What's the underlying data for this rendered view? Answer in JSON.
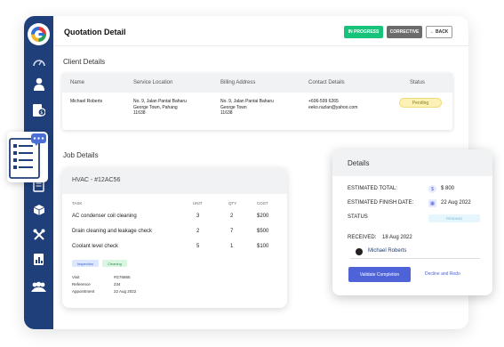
{
  "page": {
    "title": "Quotation Detail"
  },
  "header": {
    "status_label": "IN PROGRESS",
    "type_label": "CORRECTIVE",
    "back_label": "← BACK"
  },
  "sidebar": {
    "items": [
      {
        "icon": "dashboard-gauge-icon"
      },
      {
        "icon": "user-icon"
      },
      {
        "icon": "invoice-dollar-icon"
      },
      {
        "icon": "document-icon"
      },
      {
        "icon": "box-icon"
      },
      {
        "icon": "tools-icon"
      },
      {
        "icon": "report-chart-icon"
      },
      {
        "icon": "team-icon"
      }
    ]
  },
  "client": {
    "section_title": "Client Details",
    "headers": {
      "name": "Name",
      "service": "Service Location",
      "billing": "Billing Address",
      "contact": "Contact Details",
      "status": "Status"
    },
    "row": {
      "name": "Michael Roberts",
      "service": [
        "No. 9, Jalan Pantai Baharu",
        "George Town, Pahang",
        "11638"
      ],
      "billing": [
        "No. 9, Jalan Pantai Baharu",
        "George Town",
        "11638"
      ],
      "contact": [
        "+606-599 6265",
        "eeko.razlan@yahoo.com"
      ],
      "status": "Pending"
    }
  },
  "job": {
    "section_title": "Job Details",
    "card_title": "HVAC - #12AC56",
    "headers": {
      "task": "TASK",
      "unit": "UNIT",
      "qty": "QTY",
      "cost": "COST"
    },
    "rows": [
      {
        "task": "AC condenser coil cleaning",
        "unit": "3",
        "qty": "2",
        "cost": "$200"
      },
      {
        "task": "Drain cleaning and leakage check",
        "unit": "2",
        "qty": "7",
        "cost": "$500"
      },
      {
        "task": "Coolant level check",
        "unit": "5",
        "qty": "1",
        "cost": "$100"
      }
    ],
    "tags": [
      "Inspection",
      "Cleaning"
    ],
    "meta": [
      {
        "label": "Visit",
        "value": "#G76865"
      },
      {
        "label": "Reference",
        "value": "234"
      },
      {
        "label": "Appointment",
        "value": "22 Aug 2022"
      }
    ]
  },
  "details": {
    "title": "Details",
    "estimated_total_label": "ESTIMATED TOTAL:",
    "estimated_total": "$ 800",
    "finish_date_label": "ESTIMATED FINISH DATE:",
    "finish_date": "22 Aug 2022",
    "status_label": "STATUS",
    "status_value": "PENDING",
    "received_label": "RECEIVED:",
    "received_date": "18 Aug 2022",
    "assignee": "Michael Roberts",
    "validate_label": "Validate Completion",
    "decline_label": "Decline and Redo"
  },
  "colors": {
    "sidebar": "#1f3f7a",
    "in_progress": "#17c37b",
    "corrective": "#6b6b6b",
    "accent": "#4e63d8",
    "pending_bg": "#fdf1b5"
  }
}
